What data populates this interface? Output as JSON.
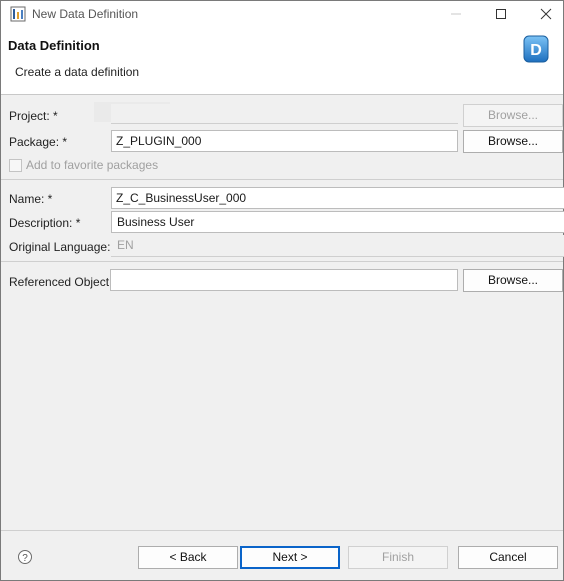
{
  "window": {
    "title": "New Data Definition",
    "minimize_icon": "minimize-icon",
    "maximize_icon": "maximize-icon",
    "close_icon": "close-icon"
  },
  "header": {
    "title": "Data Definition",
    "description": "Create a data definition",
    "badge_letter": "D"
  },
  "form": {
    "project": {
      "label": "Project: *",
      "value": "",
      "browse": "Browse..."
    },
    "package": {
      "label": "Package: *",
      "value": "Z_PLUGIN_000",
      "browse": "Browse..."
    },
    "favorite": {
      "label": "Add to favorite packages",
      "checked": false
    },
    "name": {
      "label": "Name: *",
      "value": "Z_C_BusinessUser_000"
    },
    "description": {
      "label": "Description: *",
      "value": "Business User"
    },
    "original_language": {
      "label": "Original Language:",
      "value": "EN"
    },
    "referenced_object": {
      "label": "Referenced Object:",
      "value": "",
      "browse": "Browse..."
    }
  },
  "footer": {
    "back": "< Back",
    "next": "Next >",
    "finish": "Finish",
    "cancel": "Cancel",
    "help_icon": "help-icon"
  }
}
